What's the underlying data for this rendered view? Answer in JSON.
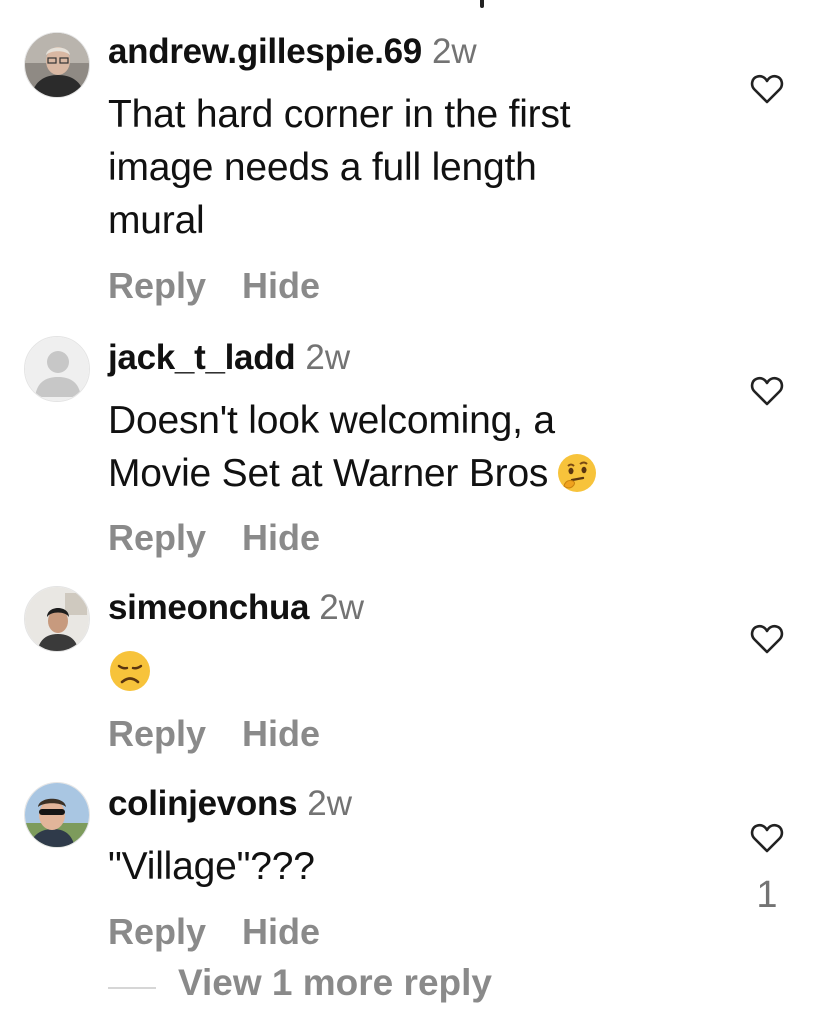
{
  "comments": [
    {
      "username": "andrew.gillespie.69",
      "time": "2w",
      "text_lines": [
        "That hard corner in the first",
        "image needs a full length",
        "mural"
      ],
      "reply_label": "Reply",
      "hide_label": "Hide",
      "like_icon": "heart-outline-icon"
    },
    {
      "username": "jack_t_ladd",
      "time": "2w",
      "text_lines": [
        "Doesn't look welcoming, a",
        "Movie Set at Warner Bros"
      ],
      "emoji": "thinking-face-emoji",
      "reply_label": "Reply",
      "hide_label": "Hide",
      "like_icon": "heart-outline-icon"
    },
    {
      "username": "simeonchua",
      "time": "2w",
      "emoji": "disappointed-face-emoji",
      "reply_label": "Reply",
      "hide_label": "Hide",
      "like_icon": "heart-outline-icon"
    },
    {
      "username": "colinjevons",
      "time": "2w",
      "text_lines": [
        "\"Village\"???"
      ],
      "reply_label": "Reply",
      "hide_label": "Hide",
      "like_icon": "heart-outline-icon",
      "like_count": "1"
    }
  ],
  "view_more_label": "View 1 more reply",
  "colors": {
    "username": "#111111",
    "secondary_text": "#737373",
    "action_text": "#8a8a8a",
    "background": "#ffffff"
  }
}
